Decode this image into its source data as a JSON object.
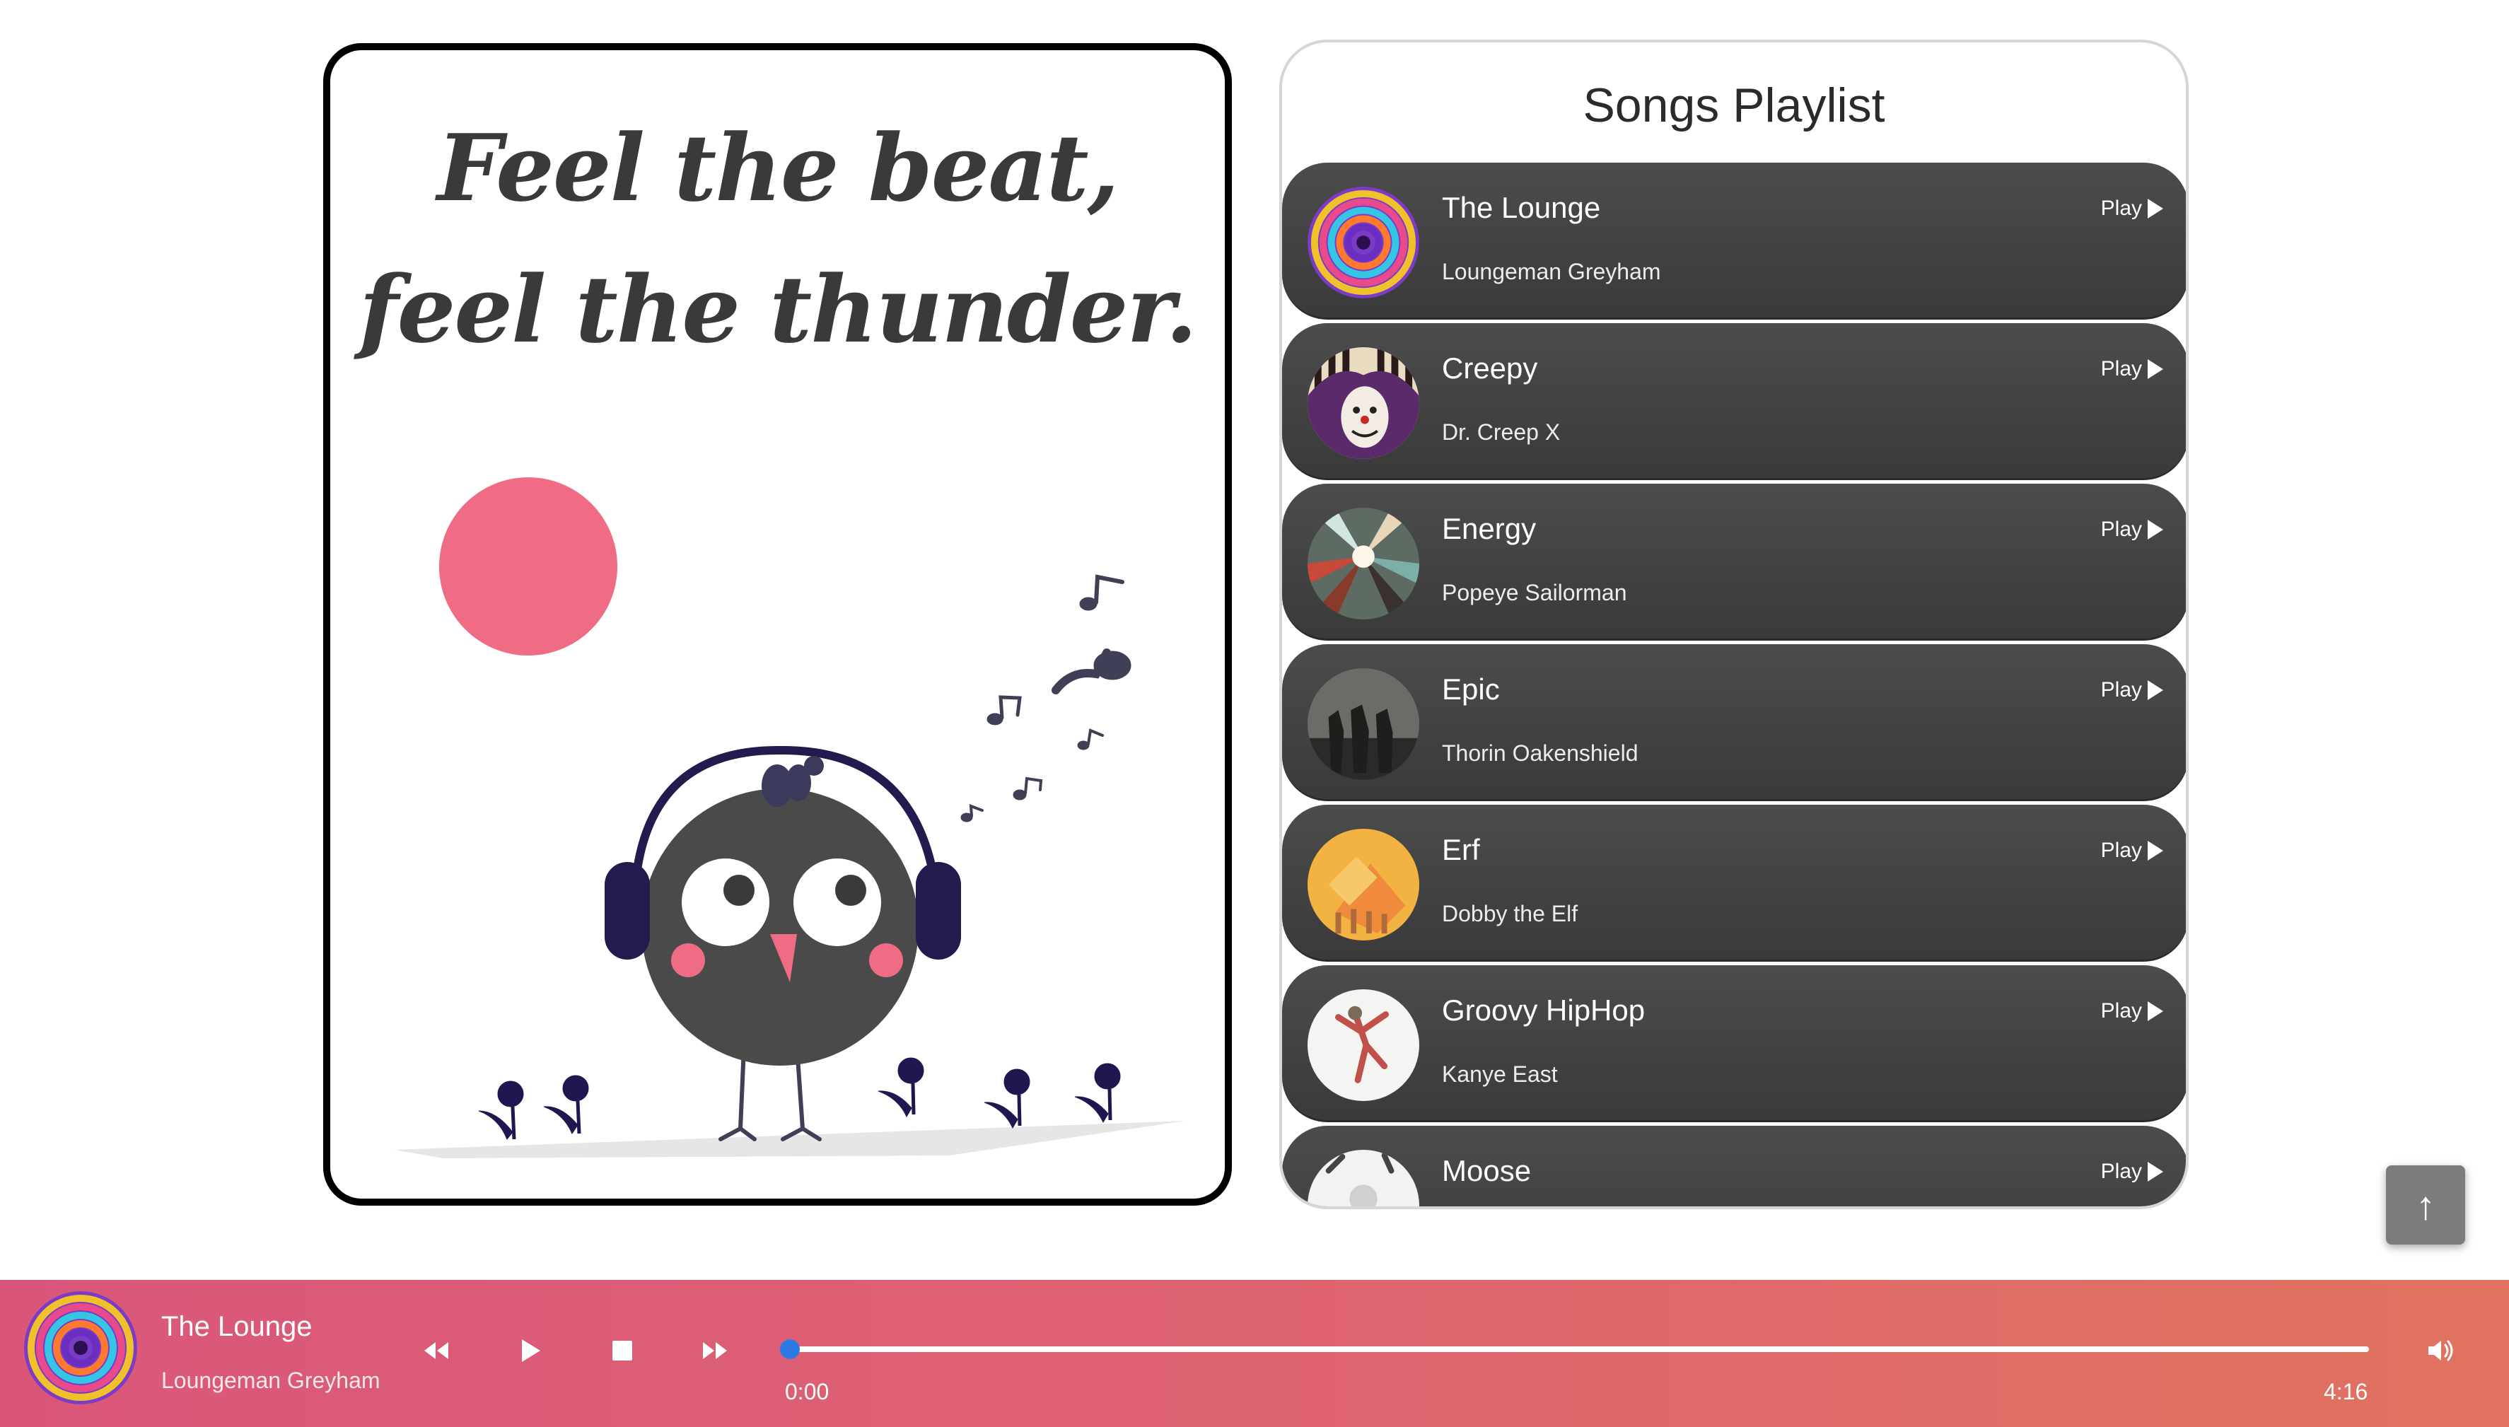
{
  "poster": {
    "quote_line1": "Feel the beat,",
    "quote_line2": "feel the thunder."
  },
  "playlist": {
    "title": "Songs Playlist",
    "play_label": "Play",
    "songs": [
      {
        "name": "The Lounge",
        "artist": "Loungeman Greyham",
        "cover": "lounge-cover"
      },
      {
        "name": "Creepy",
        "artist": "Dr. Creep X",
        "cover": "creepy-cover"
      },
      {
        "name": "Energy",
        "artist": "Popeye Sailorman",
        "cover": "energy-cover"
      },
      {
        "name": "Epic",
        "artist": "Thorin Oakenshield",
        "cover": "epic-cover"
      },
      {
        "name": "Erf",
        "artist": "Dobby the Elf",
        "cover": "erf-cover"
      },
      {
        "name": "Groovy HipHop",
        "artist": "Kanye East",
        "cover": "hiphop-cover"
      },
      {
        "name": "Moose",
        "artist": "",
        "cover": "moose-cover"
      }
    ]
  },
  "back_to_top": {
    "icon": "arrow-up-icon",
    "glyph": "↑"
  },
  "player": {
    "title": "The Lounge",
    "artist": "Loungeman Greyham",
    "current_time": "0:00",
    "duration": "4:16",
    "progress": 0.003,
    "icons": [
      "rewind-icon",
      "play-icon",
      "stop-icon",
      "fast-forward-icon",
      "volume-icon"
    ]
  },
  "colors": {
    "card_dark": "#404040",
    "accent_pink": "#ef6c84",
    "player_gradient_start": "#d9567a",
    "player_gradient_end": "#e0735f",
    "progress_thumb": "#2c7be5",
    "bird_body": "#4a4a4a",
    "headphones": "#241a4e"
  }
}
